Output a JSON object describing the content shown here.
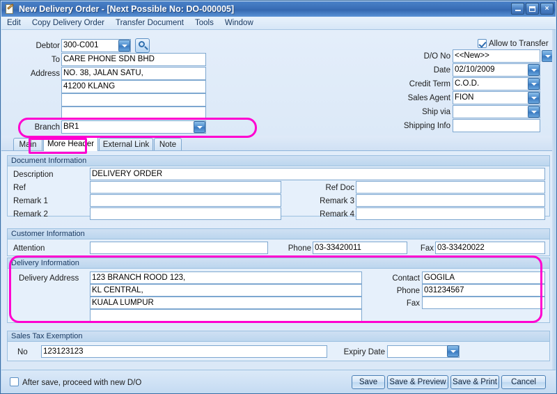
{
  "window": {
    "title": "New Delivery Order - [Next Possible No: DO-000005]",
    "icon": "document-edit-icon",
    "minimize": "minimize-icon",
    "maximize": "maximize-icon",
    "close": "×",
    "accent_color": "#3b6fb8",
    "highlight_color": "#ff00d0"
  },
  "menu": {
    "items": [
      {
        "label": "Edit"
      },
      {
        "label": "Copy Delivery Order"
      },
      {
        "label": "Transfer Document"
      },
      {
        "label": "Tools"
      },
      {
        "label": "Window"
      }
    ]
  },
  "header": {
    "left": {
      "debtor_label": "Debtor",
      "debtor_value": "300-C001",
      "to_label": "To",
      "to_value": "CARE PHONE SDN BHD",
      "address_label": "Address",
      "address_line1": "NO. 38, JALAN SATU,",
      "address_line2": "41200 KLANG",
      "address_line3": "",
      "address_line4": "",
      "branch_label": "Branch",
      "branch_value": "BR1"
    },
    "right": {
      "allow_transfer_label": "Allow to Transfer",
      "allow_transfer_checked": true,
      "dono_label": "D/O No",
      "dono_value": "<<New>>",
      "date_label": "Date",
      "date_value": "02/10/2009",
      "credit_term_label": "Credit Term",
      "credit_term_value": "C.O.D.",
      "sales_agent_label": "Sales Agent",
      "sales_agent_value": "FION",
      "ship_via_label": "Ship via",
      "ship_via_value": "",
      "shipping_info_label": "Shipping Info",
      "shipping_info_value": ""
    }
  },
  "tabs": [
    {
      "label": "Main",
      "active": false
    },
    {
      "label": "More Header",
      "active": true
    },
    {
      "label": "External Link",
      "active": false
    },
    {
      "label": "Note",
      "active": false
    }
  ],
  "document_information": {
    "title": "Document Information",
    "description_label": "Description",
    "description_value": "DELIVERY ORDER",
    "ref_label": "Ref",
    "ref_value": "",
    "remark1_label": "Remark 1",
    "remark1_value": "",
    "remark2_label": "Remark 2",
    "remark2_value": "",
    "ref_doc_label": "Ref Doc",
    "ref_doc_value": "",
    "remark3_label": "Remark 3",
    "remark3_value": "",
    "remark4_label": "Remark 4",
    "remark4_value": ""
  },
  "customer_information": {
    "title": "Customer Information",
    "attention_label": "Attention",
    "attention_value": "",
    "phone_label": "Phone",
    "phone_value": "03-33420011",
    "fax_label": "Fax",
    "fax_value": "03-33420022"
  },
  "delivery_information": {
    "title": "Delivery Information",
    "address_label": "Delivery Address",
    "address_line1": "123 BRANCH ROOD 123,",
    "address_line2": "KL CENTRAL,",
    "address_line3": "KUALA LUMPUR",
    "address_line4": "",
    "contact_label": "Contact",
    "contact_value": "GOGILA",
    "phone_label": "Phone",
    "phone_value": "031234567",
    "fax_label": "Fax",
    "fax_value": ""
  },
  "sales_tax_exemption": {
    "title": "Sales Tax Exemption",
    "no_label": "No",
    "no_value": "123123123",
    "expiry_label": "Expiry Date",
    "expiry_value": ""
  },
  "footer": {
    "after_save_label": "After save, proceed with new D/O",
    "after_save_checked": false,
    "save_label": "Save",
    "save_preview_label": "Save & Preview",
    "save_print_label": "Save & Print",
    "cancel_label": "Cancel"
  }
}
